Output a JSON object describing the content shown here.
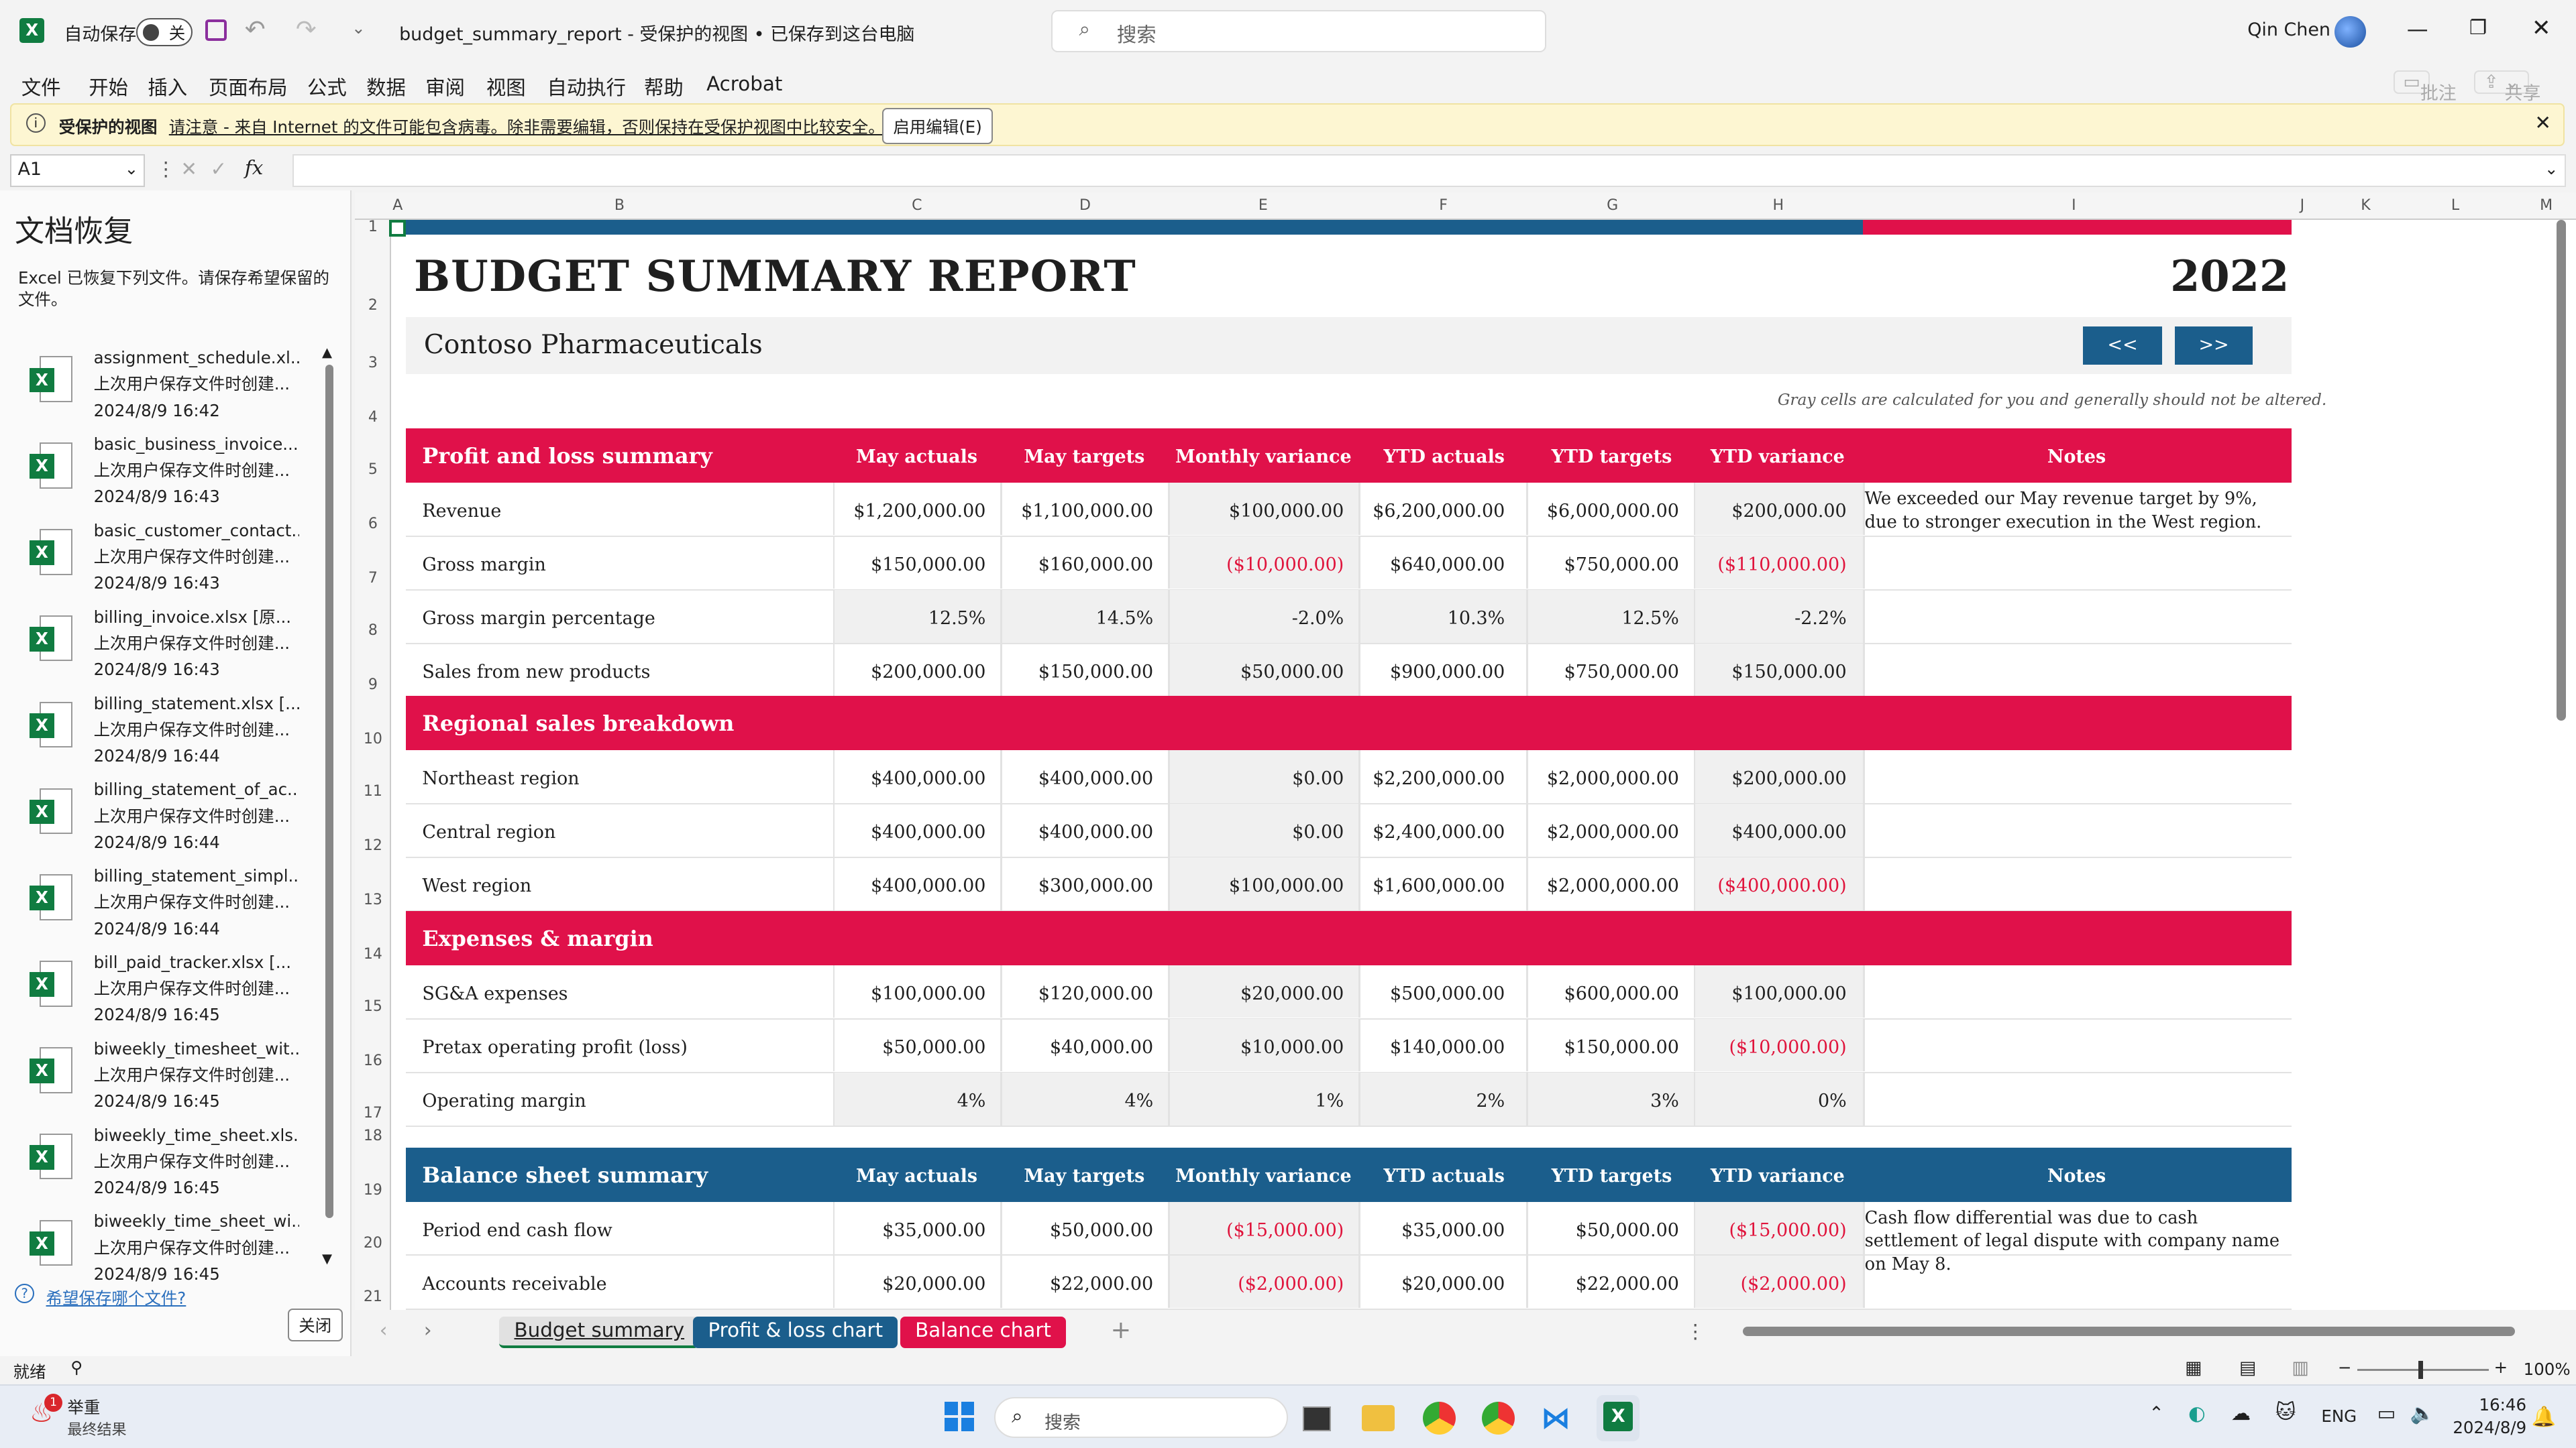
{
  "app": {
    "autosave_label": "自动保存",
    "autosave_state": "关",
    "doc_title": "budget_summary_report  -  受保护的视图 • 已保存到这台电脑",
    "search_placeholder": "搜索",
    "user": "Qin Chen"
  },
  "menu": [
    "文件",
    "开始",
    "插入",
    "页面布局",
    "公式",
    "数据",
    "审阅",
    "视图",
    "自动执行",
    "帮助",
    "Acrobat"
  ],
  "ribbon_right": {
    "comment": "批注",
    "share": "共享"
  },
  "protected": {
    "title": "受保护的视图",
    "message": "请注意 - 来自 Internet 的文件可能包含病毒。除非需要编辑，否则保持在受保护视图中比较安全。",
    "button": "启用编辑(E)"
  },
  "namebox": "A1",
  "recovery": {
    "title": "文档恢复",
    "desc": "Excel 已恢复下列文件。请保存希望保留的文件。",
    "files": [
      {
        "name": "assignment_schedule.xl...",
        "sub": "上次用户保存文件时创建...",
        "date": "2024/8/9 16:42"
      },
      {
        "name": "basic_business_invoice....",
        "sub": "上次用户保存文件时创建...",
        "date": "2024/8/9 16:43"
      },
      {
        "name": "basic_customer_contact...",
        "sub": "上次用户保存文件时创建...",
        "date": "2024/8/9 16:43"
      },
      {
        "name": "billing_invoice.xlsx  [原...",
        "sub": "上次用户保存文件时创建...",
        "date": "2024/8/9 16:43"
      },
      {
        "name": "billing_statement.xlsx  [...",
        "sub": "上次用户保存文件时创建...",
        "date": "2024/8/9 16:44"
      },
      {
        "name": "billing_statement_of_ac...",
        "sub": "上次用户保存文件时创建...",
        "date": "2024/8/9 16:44"
      },
      {
        "name": "billing_statement_simpl...",
        "sub": "上次用户保存文件时创建...",
        "date": "2024/8/9 16:44"
      },
      {
        "name": "bill_paid_tracker.xlsx  [...",
        "sub": "上次用户保存文件时创建...",
        "date": "2024/8/9 16:45"
      },
      {
        "name": "biweekly_timesheet_wit...",
        "sub": "上次用户保存文件时创建...",
        "date": "2024/8/9 16:45"
      },
      {
        "name": "biweekly_time_sheet.xls...",
        "sub": "上次用户保存文件时创建...",
        "date": "2024/8/9 16:45"
      },
      {
        "name": "biweekly_time_sheet_wi...",
        "sub": "上次用户保存文件时创建...",
        "date": "2024/8/9 16:45"
      }
    ],
    "link": "希望保存哪个文件?",
    "close": "关闭"
  },
  "cols": [
    "A",
    "B",
    "C",
    "D",
    "E",
    "F",
    "G",
    "H",
    "I",
    "J",
    "K",
    "L",
    "M"
  ],
  "rows": [
    "1",
    "2",
    "3",
    "4",
    "5",
    "6",
    "7",
    "8",
    "9",
    "10",
    "11",
    "12",
    "13",
    "14",
    "15",
    "16",
    "17",
    "18",
    "19",
    "20",
    "21"
  ],
  "report": {
    "title": "BUDGET SUMMARY REPORT",
    "year": "2022",
    "company": "Contoso Pharmaceuticals",
    "prev": "<<",
    "next": ">>",
    "hint": "Gray cells are calculated for you and generally should not be altered."
  },
  "columns": [
    "May actuals",
    "May targets",
    "Monthly variance",
    "YTD actuals",
    "YTD targets",
    "YTD variance",
    "Notes"
  ],
  "sections": {
    "pl": {
      "title": "Profit and loss summary",
      "rows": [
        {
          "label": "Revenue",
          "vals": [
            "$1,200,000.00",
            "$1,100,000.00",
            "$100,000.00",
            "$6,200,000.00",
            "$6,000,000.00",
            "$200,000.00"
          ],
          "note": "We exceeded our May revenue target by 9%, due to stronger execution in the West region."
        },
        {
          "label": "Gross margin",
          "vals": [
            "$150,000.00",
            "$160,000.00",
            "($10,000.00)",
            "$640,000.00",
            "$750,000.00",
            "($110,000.00)"
          ],
          "note": ""
        },
        {
          "label": "Gross margin percentage",
          "vals": [
            "12.5%",
            "14.5%",
            "-2.0%",
            "10.3%",
            "12.5%",
            "-2.2%"
          ],
          "note": ""
        },
        {
          "label": "Sales from new products",
          "vals": [
            "$200,000.00",
            "$150,000.00",
            "$50,000.00",
            "$900,000.00",
            "$750,000.00",
            "$150,000.00"
          ],
          "note": ""
        }
      ]
    },
    "regional": {
      "title": "Regional sales breakdown",
      "rows": [
        {
          "label": "Northeast region",
          "vals": [
            "$400,000.00",
            "$400,000.00",
            "$0.00",
            "$2,200,000.00",
            "$2,000,000.00",
            "$200,000.00"
          ],
          "note": ""
        },
        {
          "label": "Central region",
          "vals": [
            "$400,000.00",
            "$400,000.00",
            "$0.00",
            "$2,400,000.00",
            "$2,000,000.00",
            "$400,000.00"
          ],
          "note": ""
        },
        {
          "label": "West region",
          "vals": [
            "$400,000.00",
            "$300,000.00",
            "$100,000.00",
            "$1,600,000.00",
            "$2,000,000.00",
            "($400,000.00)"
          ],
          "note": ""
        }
      ]
    },
    "expenses": {
      "title": "Expenses & margin",
      "rows": [
        {
          "label": "SG&A expenses",
          "vals": [
            "$100,000.00",
            "$120,000.00",
            "$20,000.00",
            "$500,000.00",
            "$600,000.00",
            "$100,000.00"
          ],
          "note": ""
        },
        {
          "label": "Pretax operating profit (loss)",
          "vals": [
            "$50,000.00",
            "$40,000.00",
            "$10,000.00",
            "$140,000.00",
            "$150,000.00",
            "($10,000.00)"
          ],
          "note": ""
        },
        {
          "label": "Operating margin",
          "vals": [
            "4%",
            "4%",
            "1%",
            "2%",
            "3%",
            "0%"
          ],
          "note": ""
        }
      ]
    },
    "balance": {
      "title": "Balance sheet summary",
      "rows": [
        {
          "label": "Period end cash flow",
          "vals": [
            "$35,000.00",
            "$50,000.00",
            "($15,000.00)",
            "$35,000.00",
            "$50,000.00",
            "($15,000.00)"
          ],
          "note": "Cash flow differential was due to cash settlement of legal dispute with company name on May 8."
        },
        {
          "label": "Accounts receivable",
          "vals": [
            "$20,000.00",
            "$22,000.00",
            "($2,000.00)",
            "$20,000.00",
            "$22,000.00",
            "($2,000.00)"
          ],
          "note": ""
        }
      ]
    }
  },
  "tabs": [
    "Budget summary",
    "Profit & loss chart",
    "Balance chart"
  ],
  "status": {
    "ready": "就绪",
    "zoom": "100%"
  },
  "taskbar": {
    "weather_title": "举重",
    "weather_sub": "最终结果",
    "search": "搜索",
    "lang": "ENG",
    "time": "16:46",
    "date": "2024/8/9"
  },
  "colors": {
    "red": "#e0114a",
    "blue": "#1b5e8c",
    "excel_green": "#107c41"
  }
}
